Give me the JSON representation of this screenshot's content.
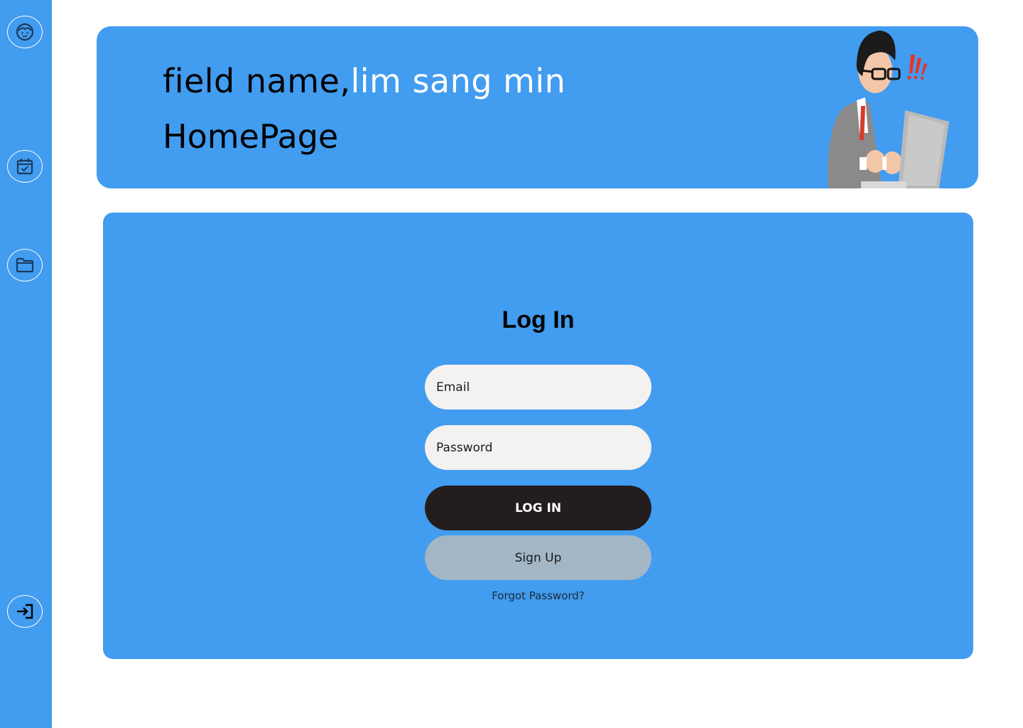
{
  "sidebar": {
    "items": [
      {
        "icon": "face-icon",
        "name": "profile"
      },
      {
        "icon": "calendar-check-icon",
        "name": "calendar"
      },
      {
        "icon": "folder-icon",
        "name": "folder"
      },
      {
        "icon": "login-icon",
        "name": "login"
      }
    ]
  },
  "header": {
    "greeting_prefix": "field name,",
    "user_name": "lim sang min",
    "page_title": "HomePage"
  },
  "login": {
    "title": "Log In",
    "email_placeholder": "Email",
    "password_placeholder": "Password",
    "login_button": "LOG IN",
    "signup_button": "Sign Up",
    "forgot_link": "Forgot Password?"
  },
  "colors": {
    "primary": "#429cef",
    "login_button": "#231d1e",
    "signup_button": "#a2b6c5",
    "input_bg": "#f3f2f1"
  }
}
